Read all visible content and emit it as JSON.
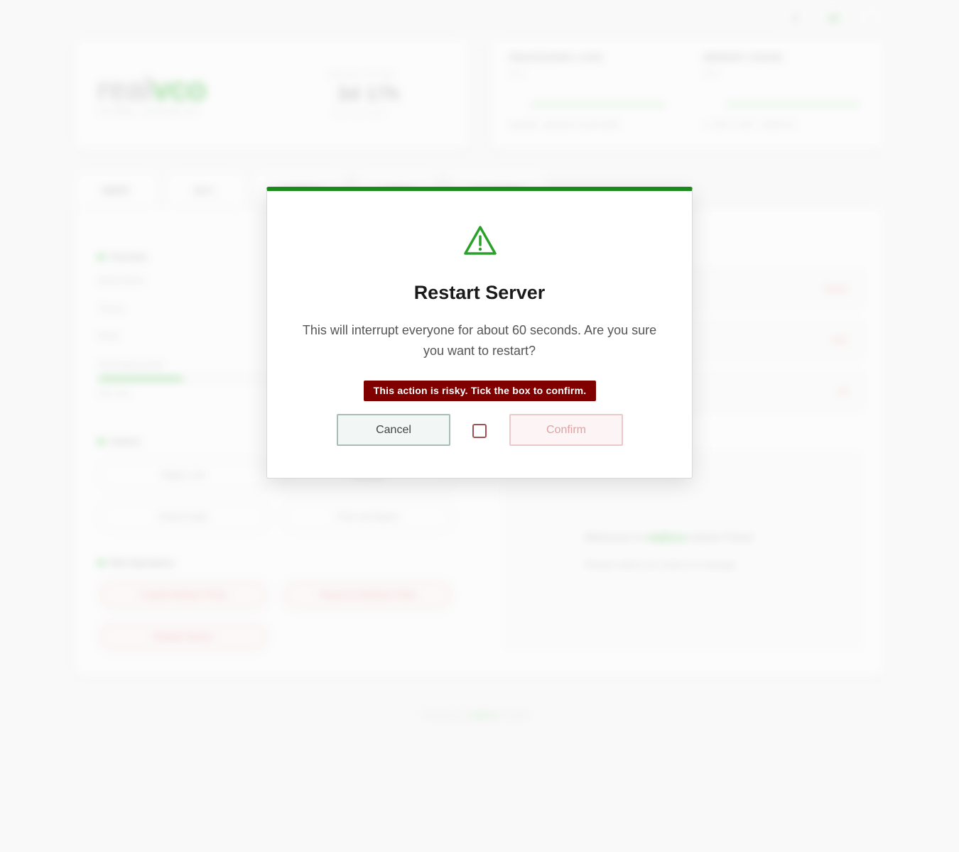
{
  "background": {
    "topbar": {
      "lang": "EN"
    },
    "brand": {
      "logo_part1": "real",
      "logo_part2": "vco",
      "subtitle": "Life Sitting · Community Hub",
      "uptime_label": "SERVER UPTIME",
      "uptime_value": "3d 17h",
      "uptime_sub": "Since last restart"
    },
    "metrics": [
      {
        "title": "PROCESSING LOAD",
        "value": "12%",
        "foot": "Avg load · optimal for current traffic"
      },
      {
        "title": "MEMORY USAGE",
        "value": "34%",
        "foot": "4.2 GB / 12 GB · 2.8GB Free"
      }
    ],
    "tabs": [
      "HOST",
      "SEC.",
      "CONFIG",
      "LOGS",
      "PLUGINS"
    ],
    "sections": {
      "overview": "Overview",
      "actions": "Actions",
      "risk": "Risk Operations"
    },
    "kv": [
      "World Name",
      "Theme",
      "Mode",
      "Disk Space Used",
      "50% used"
    ],
    "actions": [
      "Magic Link",
      "Manage",
      "Export Data",
      "Free Up Space"
    ],
    "risk_actions": [
      "Create Restore Point",
      "Revert to Restore Point",
      "Restart Server"
    ],
    "right_rows": [
      "Reset",
      "Kick",
      "All"
    ],
    "welcome": {
      "prefix": "Welcome to",
      "brand": "realvco",
      "suffix": "Admin Panel",
      "line2": "Please select an Action to manage"
    },
    "footer": {
      "prefix": "Powered by",
      "brand": "realvco",
      "suffix": "© 2024"
    }
  },
  "modal": {
    "icon": "warning-triangle-icon",
    "title": "Restart Server",
    "message": "This will interrupt everyone for about 60 seconds. Are you sure you want to restart?",
    "risk_notice": "This action is risky. Tick the box to confirm.",
    "cancel_label": "Cancel",
    "confirm_label": "Confirm",
    "confirm_checked": false,
    "accent_color": "#1a8a1a",
    "risk_color": "#800000"
  }
}
